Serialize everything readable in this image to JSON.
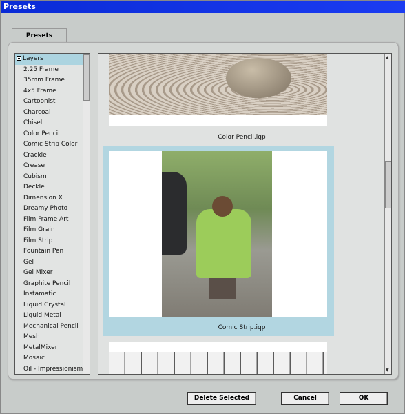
{
  "window": {
    "title": "Presets"
  },
  "tabs": [
    {
      "label": "Presets",
      "active": true
    }
  ],
  "tree": {
    "root": "Layers",
    "items": [
      "2.25 Frame",
      "35mm Frame",
      "4x5 Frame",
      "Cartoonist",
      "Charcoal",
      "Chisel",
      "Color Pencil",
      "Comic Strip Color",
      "Crackle",
      "Crease",
      "Cubism",
      "Deckle",
      "Dimension X",
      "Dreamy Photo",
      "Film Frame Art",
      "Film Grain",
      "Film Strip",
      "Fountain Pen",
      "Gel",
      "Gel Mixer",
      "Graphite Pencil",
      "Instamatic",
      "Liquid Crystal",
      "Liquid Metal",
      "Mechanical Pencil",
      "Mesh",
      "MetalMixer",
      "Mosaic",
      "Oil - Impressionism"
    ]
  },
  "previews": [
    {
      "caption": "Color Pencil.iqp"
    },
    {
      "caption": "Comic Strip.iqp",
      "selected": true
    },
    {
      "caption": ""
    }
  ],
  "buttons": {
    "delete": "Delete Selected",
    "cancel": "Cancel",
    "ok": "OK"
  },
  "colors": {
    "titlebar": "#1b3cf2",
    "selection": "#acd4e0"
  }
}
